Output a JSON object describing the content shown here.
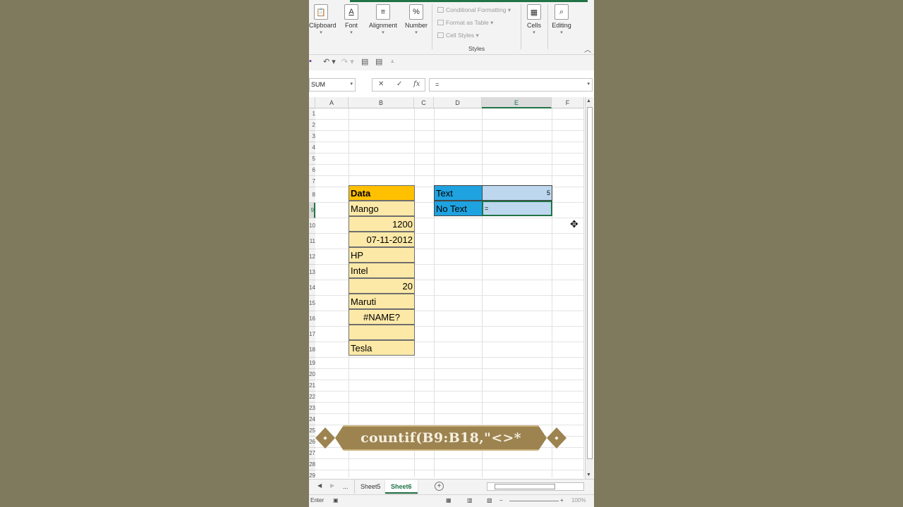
{
  "ribbon": {
    "groups": [
      {
        "label": "Clipboard",
        "icon": "clipboard-icon",
        "glyph": "📋"
      },
      {
        "label": "Font",
        "icon": "font-icon",
        "glyph": "A"
      },
      {
        "label": "Alignment",
        "icon": "alignment-icon",
        "glyph": "≡"
      },
      {
        "label": "Number",
        "icon": "percent-icon",
        "glyph": "%"
      },
      {
        "label": "Cells",
        "icon": "cells-icon",
        "glyph": "▦"
      },
      {
        "label": "Editing",
        "icon": "search-icon",
        "glyph": "⌕"
      }
    ],
    "styles": {
      "conditional_formatting": "Conditional Formatting",
      "format_as_table": "Format as Table",
      "cell_styles": "Cell Styles",
      "group_label": "Styles"
    }
  },
  "formula_bar": {
    "name_box": "SUM",
    "content": "="
  },
  "columns": [
    "A",
    "B",
    "C",
    "D",
    "E",
    "F"
  ],
  "rows": [
    "1",
    "2",
    "3",
    "4",
    "5",
    "6",
    "7",
    "8",
    "9",
    "10",
    "11",
    "12",
    "13",
    "14",
    "15",
    "16",
    "17",
    "18",
    "19",
    "20",
    "21",
    "22",
    "23",
    "24",
    "25",
    "26",
    "27",
    "28",
    "29"
  ],
  "data_column": {
    "header": "Data",
    "values": [
      "Mango",
      "1200",
      "07-11-2012",
      "HP",
      "Intel",
      "20",
      "Maruti",
      "#NAME?",
      "",
      "Tesla"
    ]
  },
  "summary": {
    "text_label": "Text",
    "text_value": "5",
    "no_text_label": "No Text",
    "no_text_value": "="
  },
  "overlay": {
    "banner_text": "countif(B9:B18,\"<>*"
  },
  "sheet_tabs": {
    "ellipsis": "...",
    "tabs": [
      "Sheet5",
      "Sheet6"
    ],
    "active": "Sheet6"
  },
  "status_bar": {
    "mode": "Enter",
    "zoom": "100%"
  },
  "colors": {
    "excel_green": "#217346",
    "header_fill": "#ffc000",
    "data_fill": "#fde9a7",
    "label_fill": "#1fa2e0",
    "value_fill": "#bdd7ee"
  }
}
